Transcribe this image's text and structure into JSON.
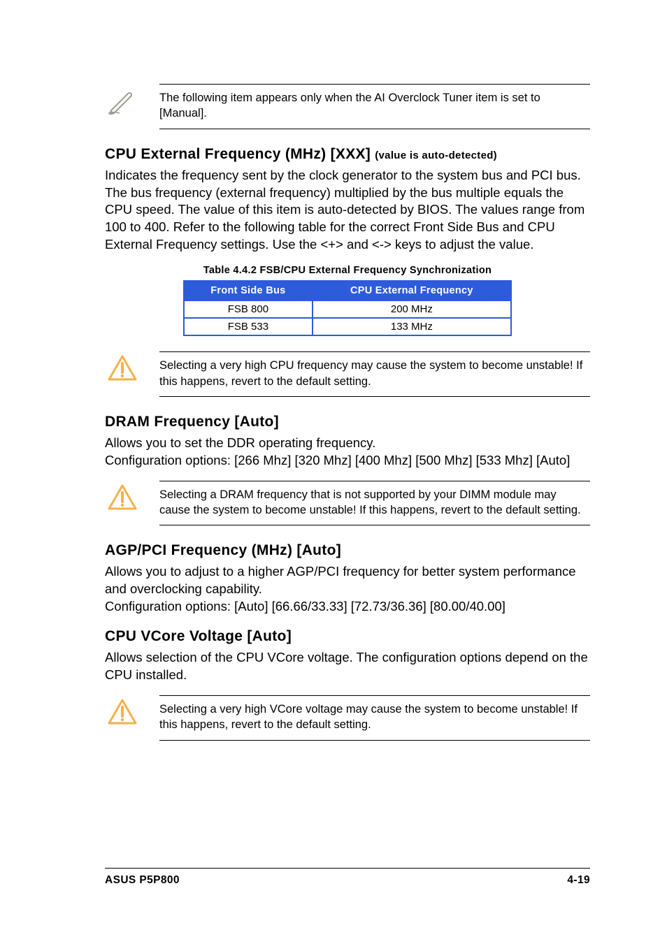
{
  "note1": {
    "text": "The following item appears only when the AI Overclock Tuner item is set to [Manual]."
  },
  "section_cpu_ext": {
    "heading_main": "CPU External Frequency (MHz) [XXX] ",
    "heading_sub": "(value is auto-detected)",
    "body": "Indicates the frequency sent by the clock generator to the system bus and PCI bus. The bus frequency (external frequency) multiplied by the bus multiple equals the CPU speed. The value of this item is auto-detected by BIOS. The values range from 100 to 400. Refer to the following table for the correct Front Side Bus and CPU External Frequency settings. Use the <+> and <-> keys to adjust the value."
  },
  "table": {
    "caption": "Table 4.4.2 FSB/CPU External Frequency Synchronization",
    "head1": "Front Side Bus",
    "head2": "CPU External Frequency",
    "rows": [
      {
        "c1": "FSB 800",
        "c2": "200 MHz"
      },
      {
        "c1": "FSB 533",
        "c2": "133 MHz"
      }
    ]
  },
  "note2": {
    "text": "Selecting a very high CPU frequency may cause the system to become unstable! If this happens, revert to the default setting."
  },
  "section_dram": {
    "heading": "DRAM Frequency [Auto]",
    "body1": "Allows you to set the DDR operating frequency.",
    "body2": "Configuration options: [266 Mhz] [320 Mhz] [400 Mhz] [500 Mhz] [533 Mhz] [Auto]"
  },
  "note3": {
    "text": "Selecting a DRAM frequency that is not supported by your DIMM module may cause the system to become unstable! If this happens, revert to the default setting."
  },
  "section_agp": {
    "heading": "AGP/PCI Frequency (MHz) [Auto]",
    "body1": "Allows you to adjust to a higher AGP/PCI frequency for better system performance and overclocking capability.",
    "body2": "Configuration options: [Auto] [66.66/33.33] [72.73/36.36] [80.00/40.00]"
  },
  "section_vcore": {
    "heading": "CPU VCore Voltage [Auto]",
    "body": "Allows selection of the CPU VCore voltage. The configuration options depend on the CPU installed."
  },
  "note4": {
    "text": "Selecting a very high VCore voltage may cause the system to become unstable! If this happens, revert to the default setting."
  },
  "footer": {
    "left": "ASUS P5P800",
    "right": "4-19"
  }
}
